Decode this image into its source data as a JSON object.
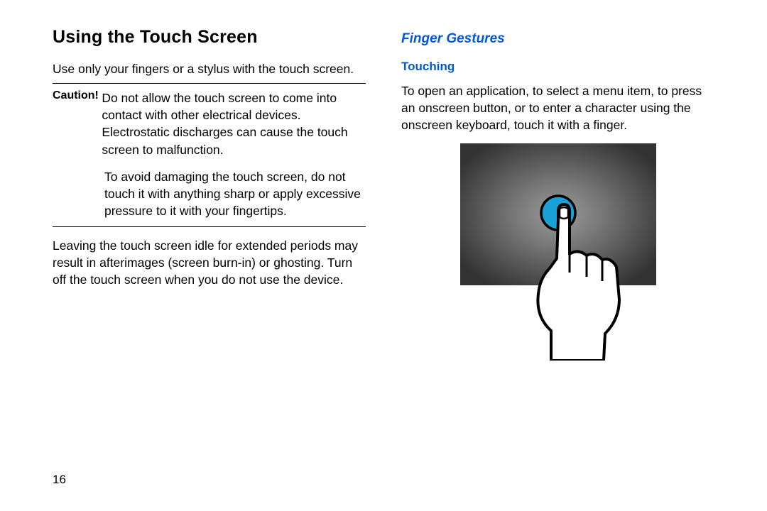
{
  "left": {
    "heading": "Using the Touch Screen",
    "intro": "Use only your fingers or a stylus with the touch screen.",
    "caution_label": "Caution! ",
    "caution_p1": "Do not allow the touch screen to come into contact with other electrical devices. Electrostatic discharges can cause the touch screen to malfunction.",
    "caution_p2": "To avoid damaging the touch screen, do not touch it with anything sharp or apply excessive pressure to it with your fingertips.",
    "note": "Leaving the touch screen idle for extended periods may result in afterimages (screen burn-in) or ghosting. Turn off the touch screen when you do not use the device."
  },
  "right": {
    "heading": "Finger Gestures",
    "subheading": "Touching",
    "body": "To open an application, to select a menu item, to press an onscreen button, or to enter a character using the onscreen keyboard, touch it with a finger."
  },
  "page_number": "16"
}
